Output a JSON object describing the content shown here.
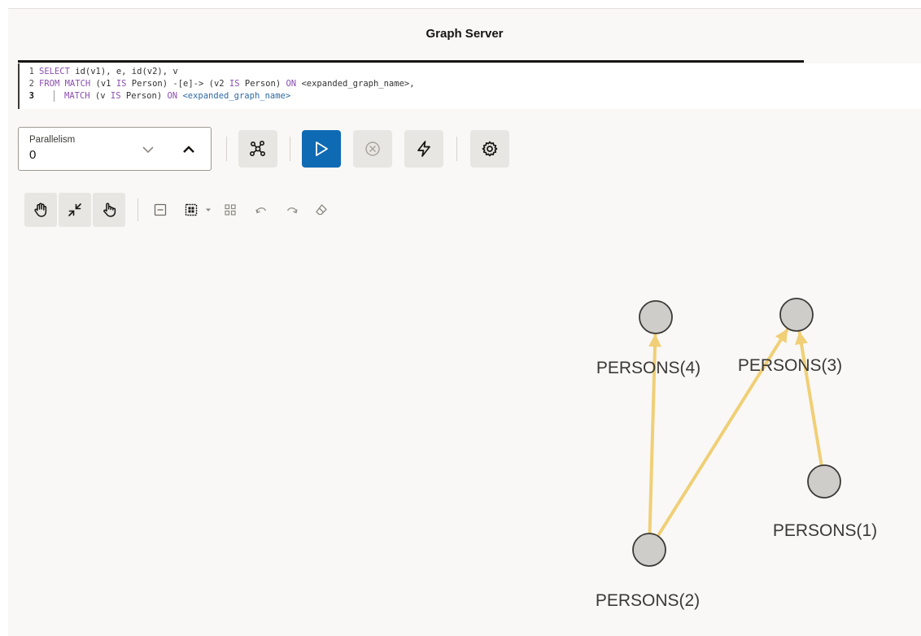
{
  "header": {
    "title": "Graph Server"
  },
  "editor": {
    "lines": [
      {
        "num": "1",
        "parts": [
          {
            "t": "SELECT",
            "k": "kw"
          },
          {
            "t": " id(v1), e, id(v2), v",
            "k": ""
          }
        ]
      },
      {
        "num": "2",
        "parts": [
          {
            "t": "FROM MATCH",
            "k": "kw"
          },
          {
            "t": " (v1 ",
            "k": ""
          },
          {
            "t": "IS",
            "k": "kw"
          },
          {
            "t": " Person) -[e]-> (v2 ",
            "k": ""
          },
          {
            "t": "IS",
            "k": "kw"
          },
          {
            "t": " Person) ",
            "k": ""
          },
          {
            "t": "ON",
            "k": "kw"
          },
          {
            "t": " <expanded_graph_name>,",
            "k": ""
          }
        ]
      },
      {
        "num": "3",
        "parts": [
          {
            "t": "MATCH",
            "k": "kw"
          },
          {
            "t": " (v ",
            "k": ""
          },
          {
            "t": "IS",
            "k": "kw"
          },
          {
            "t": " Person) ",
            "k": ""
          },
          {
            "t": "ON",
            "k": "kw"
          },
          {
            "t": " ",
            "k": ""
          },
          {
            "t": "<expanded_graph_name>",
            "k": "ph"
          }
        ]
      }
    ]
  },
  "toolbar": {
    "parallelism_label": "Parallelism",
    "parallelism_value": "0",
    "icons": {
      "graph_view": "graph-network-icon",
      "run": "play-icon",
      "cancel": "cancel-circle-icon",
      "fast": "lightning-icon",
      "settings": "gear-icon"
    }
  },
  "graph_toolbar": {
    "icons": [
      "pan-hand-icon",
      "collapse-icon",
      "select-hand-icon",
      "minimize-icon",
      "layout-grid-icon",
      "dropdown-caret-icon",
      "group-icon",
      "undo-icon",
      "redo-icon",
      "eraser-icon"
    ]
  },
  "graph": {
    "nodes": [
      {
        "id": "p4",
        "label": "PERSONS(4)"
      },
      {
        "id": "p3",
        "label": "PERSONS(3)"
      },
      {
        "id": "p1",
        "label": "PERSONS(1)"
      },
      {
        "id": "p2",
        "label": "PERSONS(2)"
      }
    ],
    "edges": [
      {
        "from": "p2",
        "to": "p4"
      },
      {
        "from": "p2",
        "to": "p3"
      },
      {
        "from": "p1",
        "to": "p3"
      }
    ],
    "colors": {
      "edge": "#f0cf76",
      "node_fill": "#cfcdc9",
      "node_stroke": "#3a3936"
    }
  }
}
